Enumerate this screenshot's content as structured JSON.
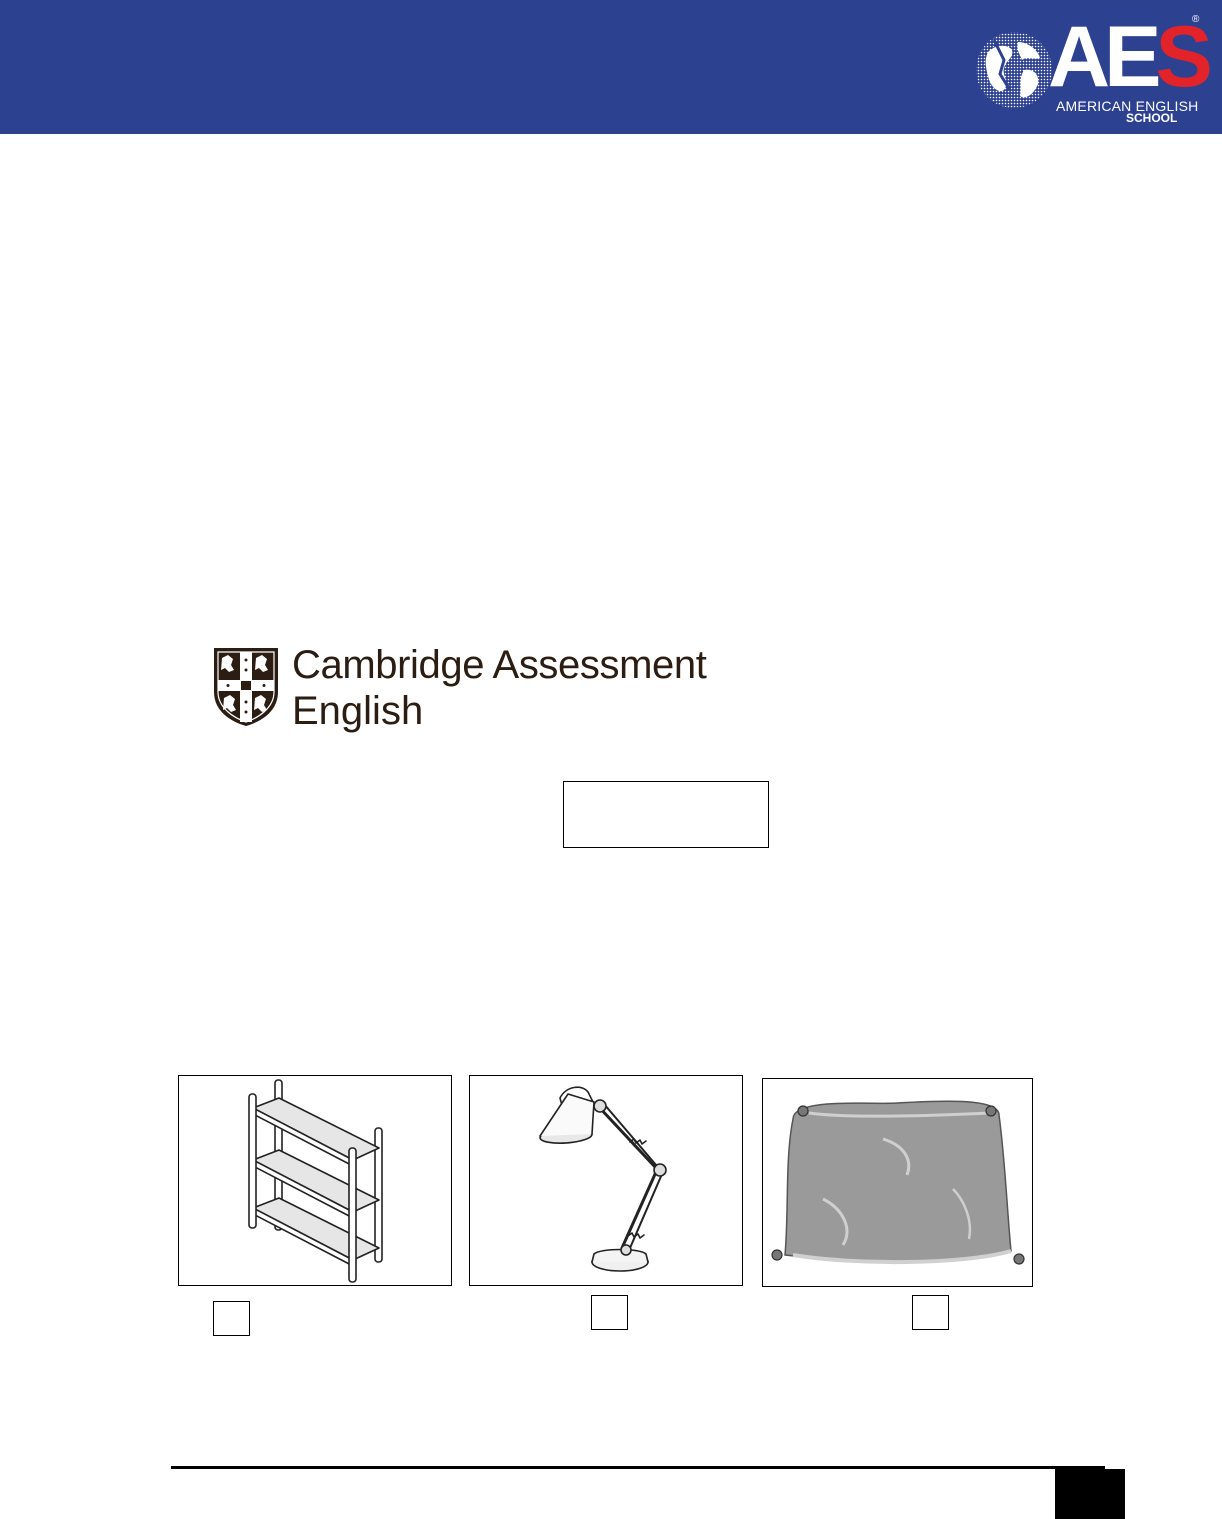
{
  "header": {
    "band_color": "#2d4191",
    "logo": {
      "letters": "AES",
      "registered": "®",
      "line1": "AMERICAN ENGLISH",
      "line2": "SCHOOL",
      "accent_color": "#e2232a"
    }
  },
  "exam_logo": {
    "line1": "Cambridge Assessment",
    "line2": "English",
    "text_color": "#2b1d12"
  },
  "pictures": [
    {
      "icon": "bookshelf-icon"
    },
    {
      "icon": "desk-lamp-icon"
    },
    {
      "icon": "cushion-icon"
    }
  ]
}
